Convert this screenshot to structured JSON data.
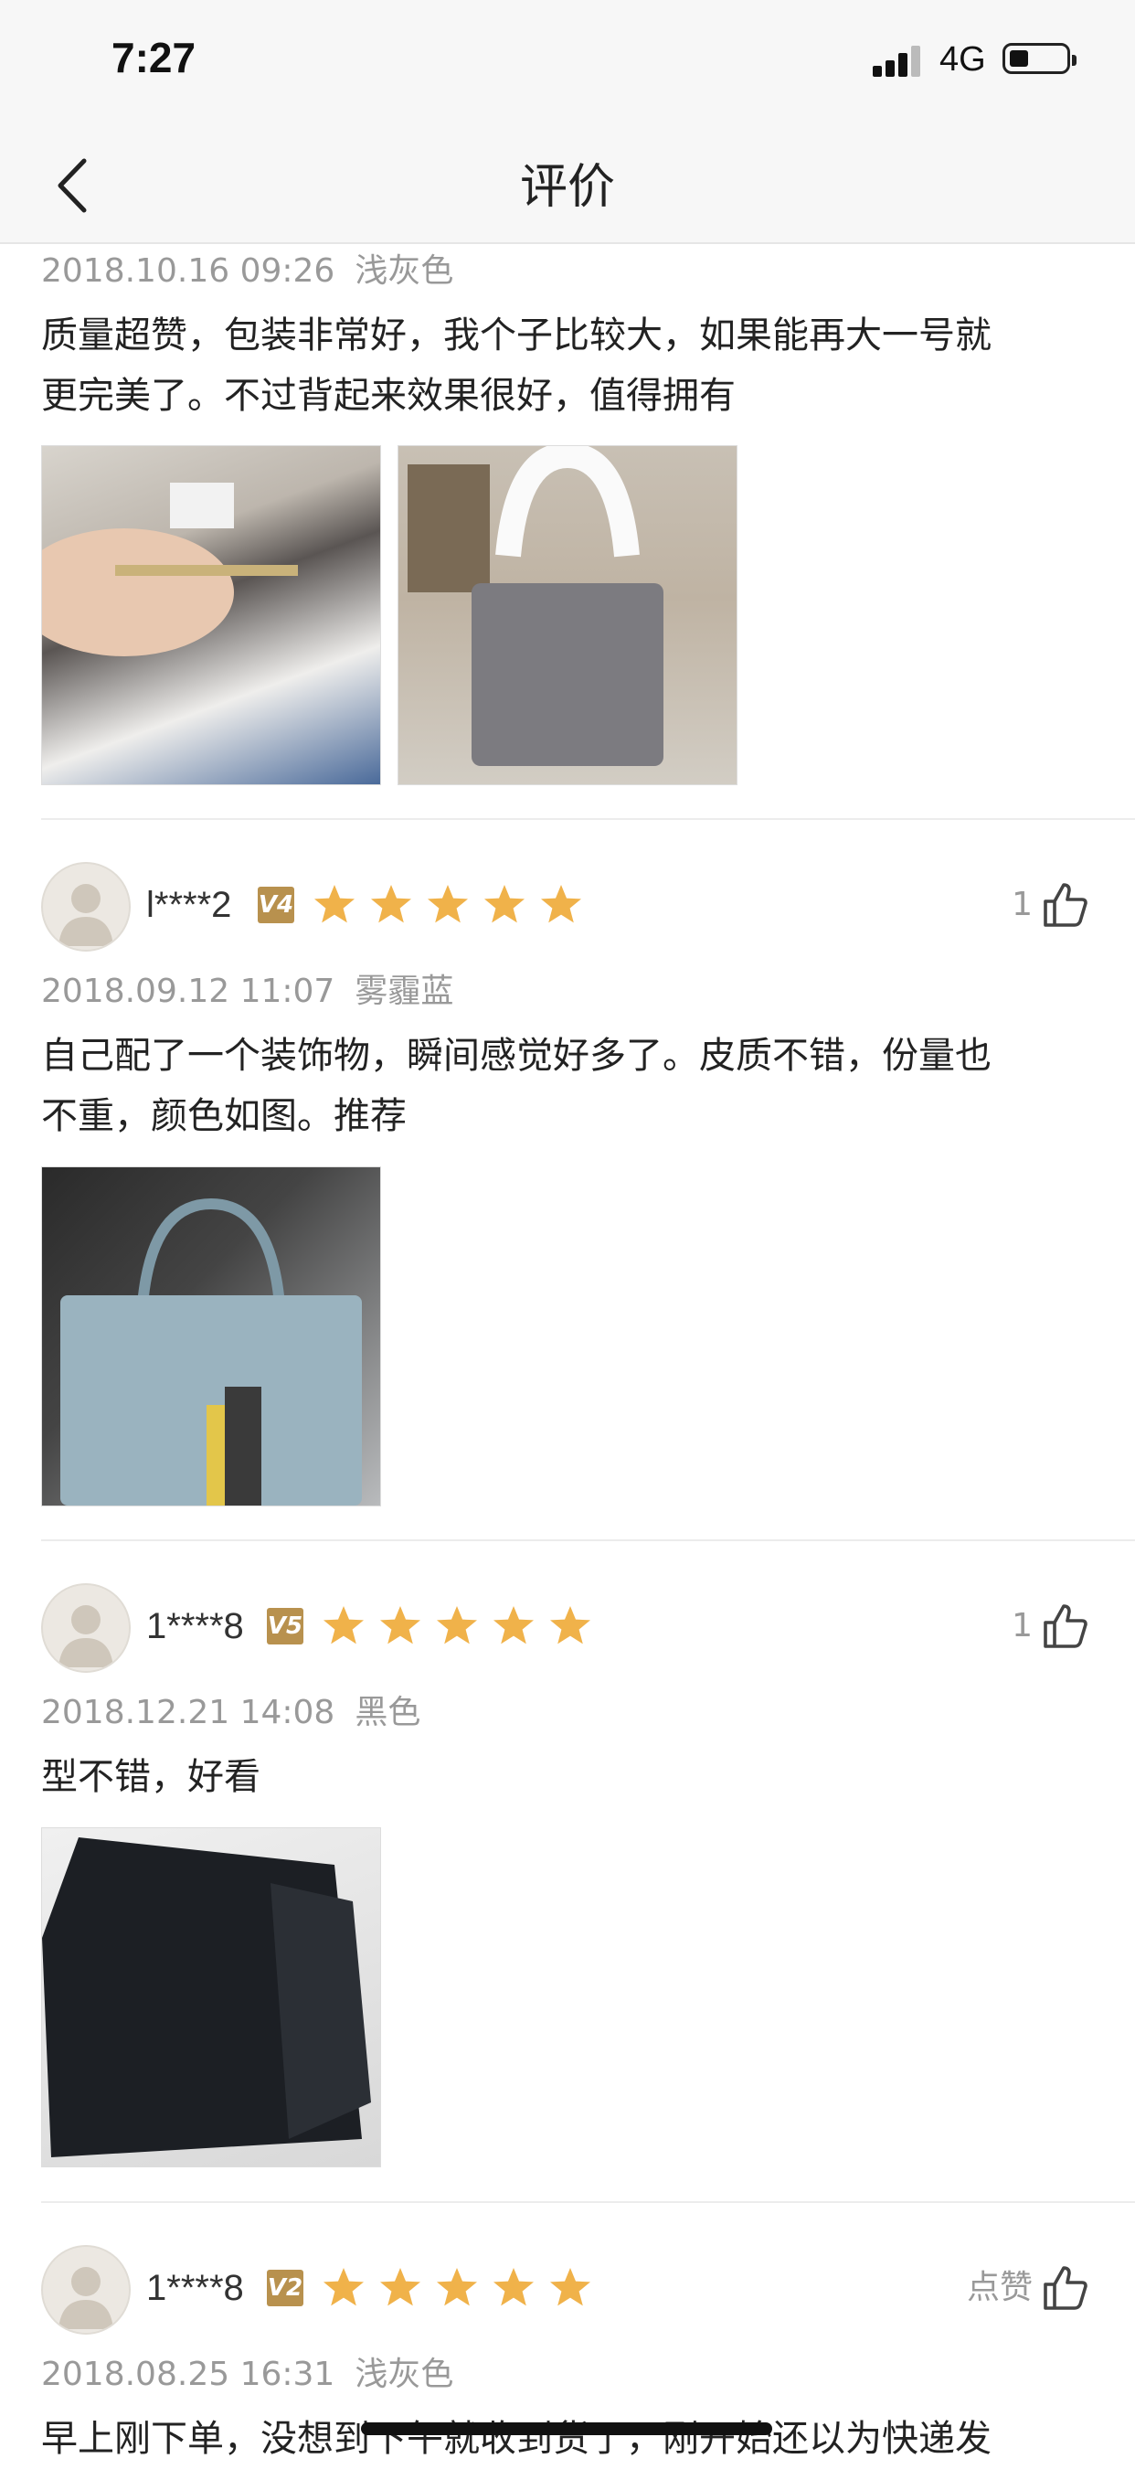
{
  "status": {
    "time": "7:27",
    "network": "4G"
  },
  "nav": {
    "title": "评价"
  },
  "reviews": [
    {
      "date": "2018.10.16 09:26",
      "spec": "浅灰色",
      "content_lines": [
        "质量超赞，包装非常好，我个子比较大，如果能再大一号就",
        "更完美了。不过背起来效果很好，值得拥有"
      ]
    },
    {
      "user": "l****2",
      "level": "V4",
      "rating": 5,
      "likes": "1",
      "date": "2018.09.12 11:07",
      "spec": "雾霾蓝",
      "content_lines": [
        "自己配了一个装饰物，瞬间感觉好多了。皮质不错，份量也",
        "不重，颜色如图。推荐"
      ]
    },
    {
      "user": "1****8",
      "level": "V5",
      "rating": 5,
      "likes": "1",
      "date": "2018.12.21 14:08",
      "spec": "黑色",
      "content_lines": [
        "型不错，好看"
      ]
    },
    {
      "user": "1****8",
      "level": "V2",
      "rating": 5,
      "likes": "点赞",
      "date": "2018.08.25 16:31",
      "spec": "浅灰色",
      "content_lines": [
        "早上刚下单，没想到下午就收到货了，刚开始还以为快递发"
      ]
    }
  ],
  "colors": {
    "star": "#f0b24a",
    "badge": "#b8914e",
    "divider": "#ececec",
    "meta": "#999999"
  }
}
